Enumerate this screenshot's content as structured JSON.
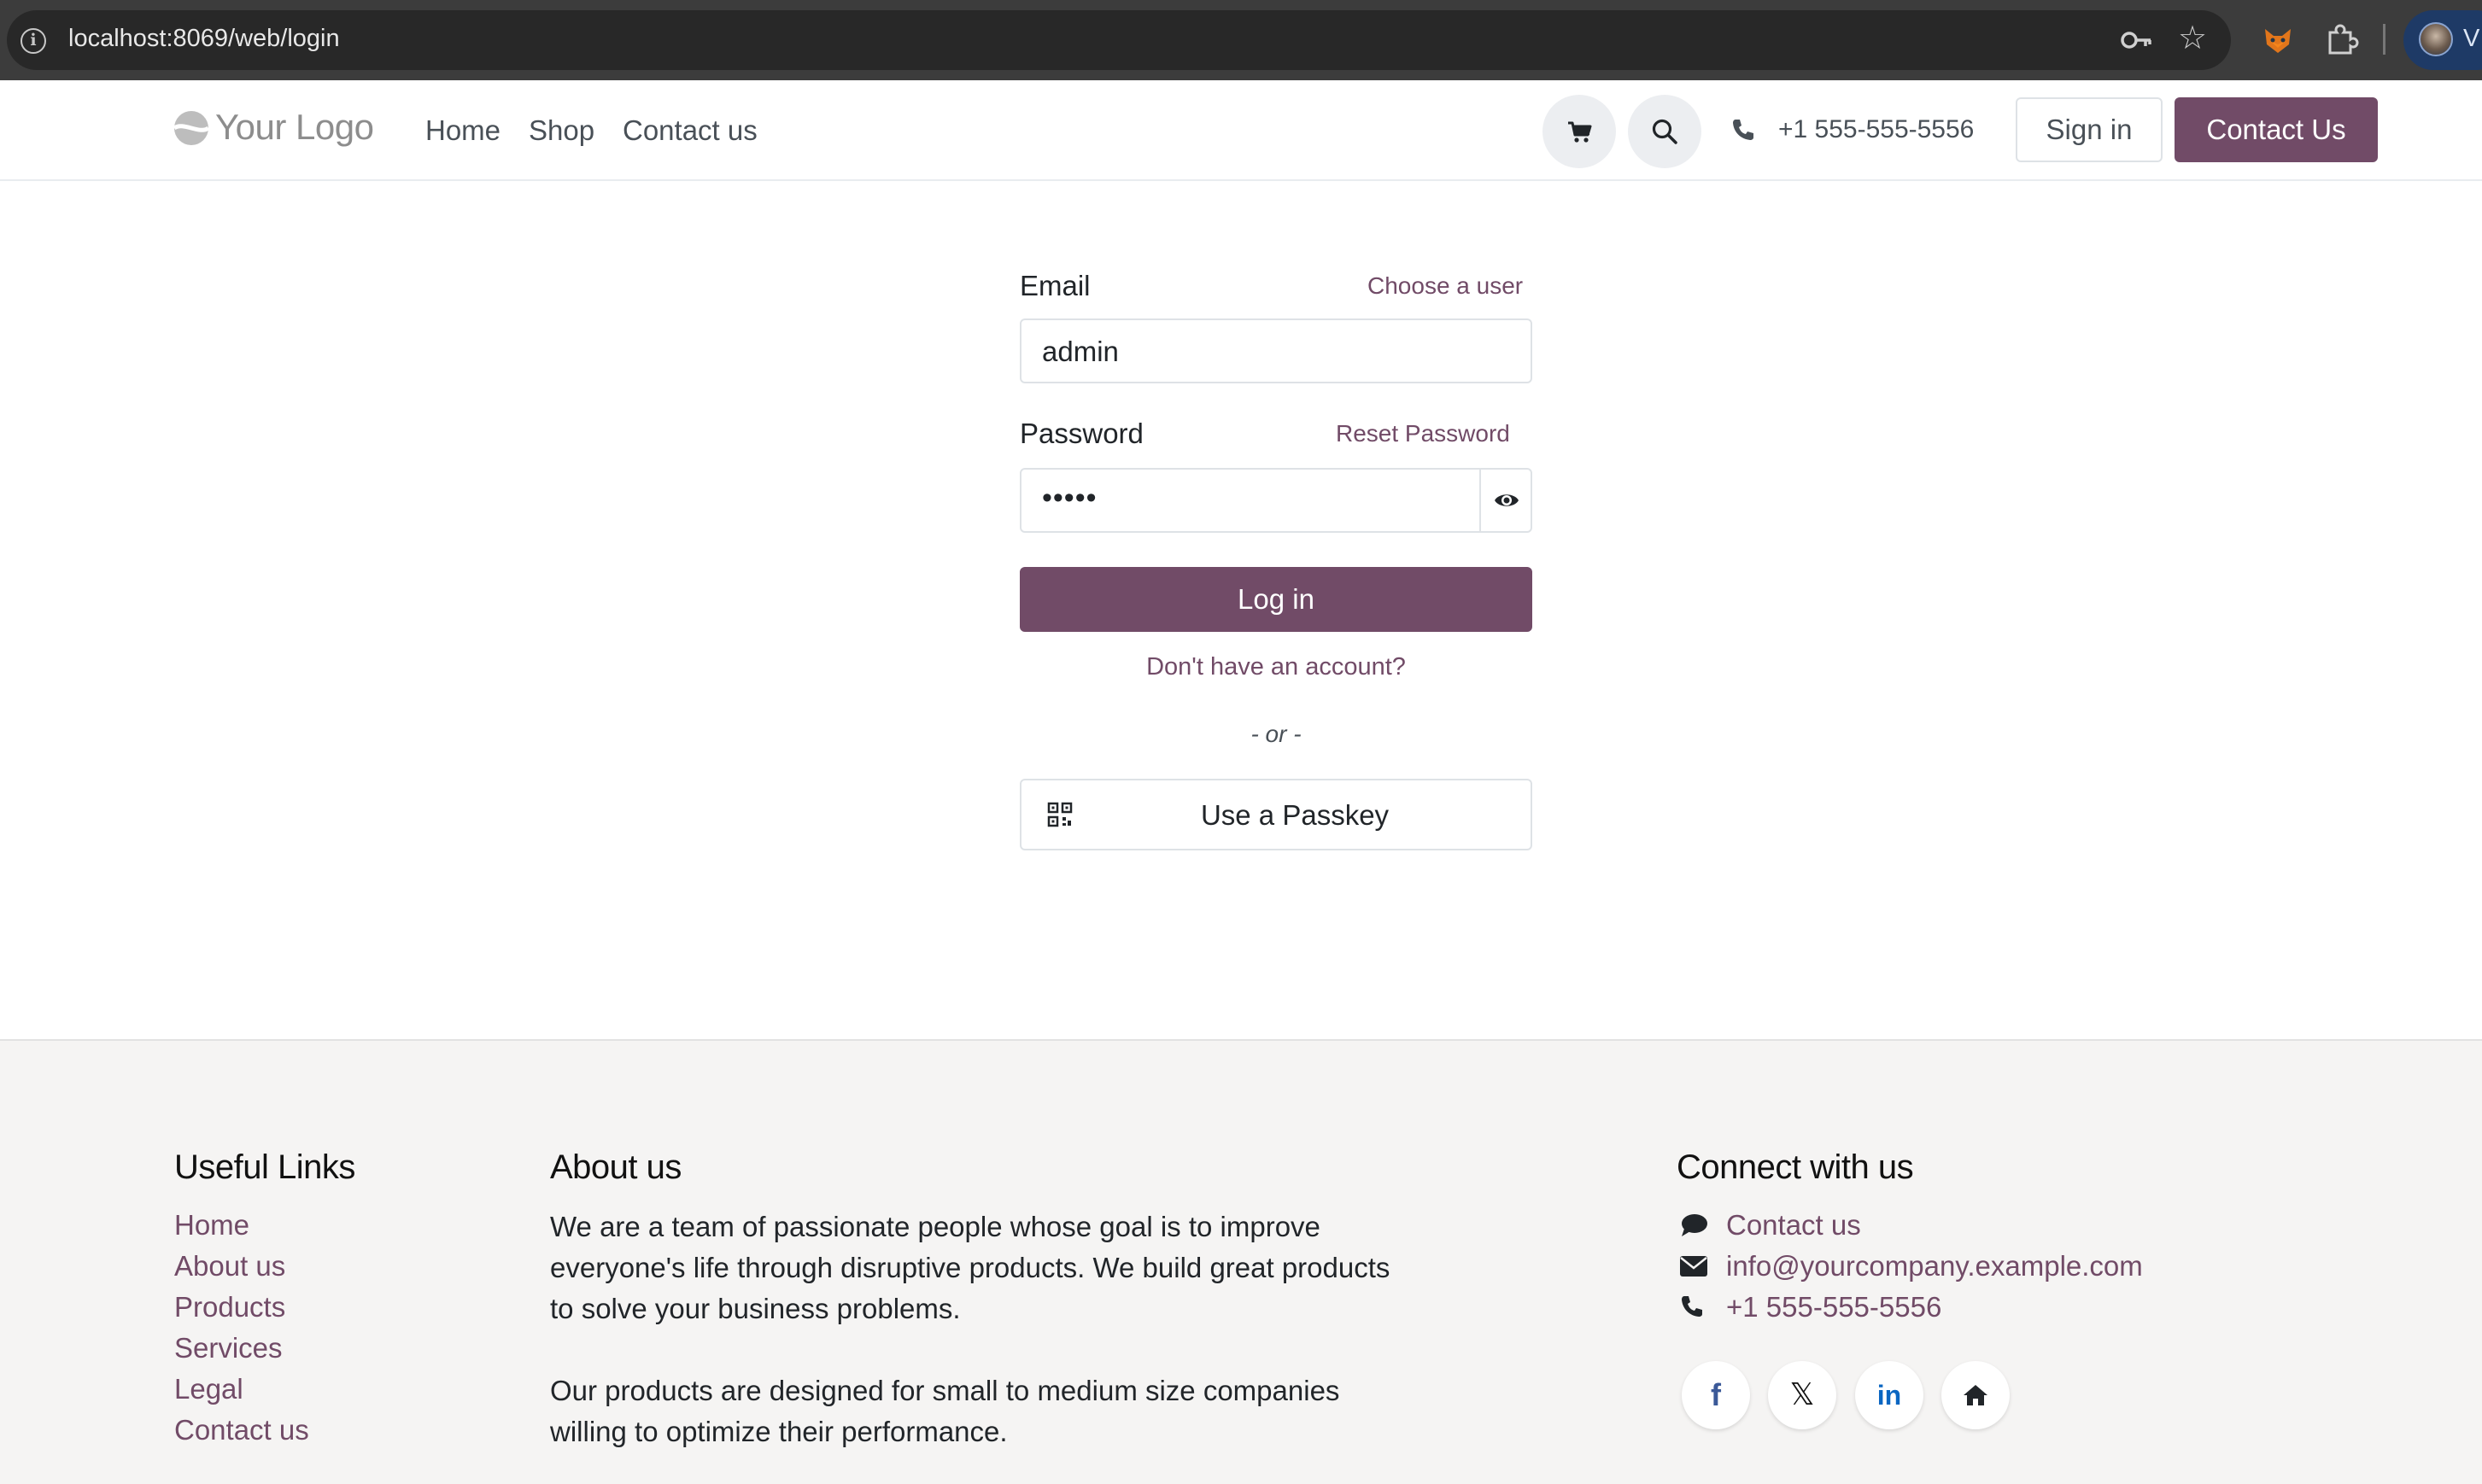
{
  "browser": {
    "url": "localhost:8069/web/login",
    "profile_initial": "V"
  },
  "header": {
    "logo_text": "Your Logo",
    "nav": [
      "Home",
      "Shop",
      "Contact us"
    ],
    "phone": "+1 555-555-5556",
    "sign_in_label": "Sign in",
    "contact_label": "Contact Us"
  },
  "login": {
    "email_label": "Email",
    "choose_user_label": "Choose a user",
    "email_value": "admin",
    "password_label": "Password",
    "reset_password_label": "Reset Password",
    "password_masked": "•••••",
    "login_label": "Log in",
    "signup_label": "Don't have an account?",
    "or_label": "- or -",
    "passkey_label": "Use a Passkey"
  },
  "footer": {
    "useful_links": {
      "title": "Useful Links",
      "items": [
        "Home",
        "About us",
        "Products",
        "Services",
        "Legal",
        "Contact us"
      ]
    },
    "about": {
      "title": "About us",
      "lines": [
        "We are a team of passionate people whose goal is to improve",
        "everyone's life through disruptive products. We build great products",
        "to solve your business problems.",
        "Our products are designed for small to medium size companies",
        "willing to optimize their performance."
      ]
    },
    "connect": {
      "title": "Connect with us",
      "contact_us": "Contact us",
      "email": "info@yourcompany.example.com",
      "phone": "+1 555-555-5556",
      "socials": [
        "facebook-icon",
        "x-icon",
        "linkedin-icon",
        "home-icon"
      ]
    }
  },
  "colors": {
    "brand": "#714b67",
    "footer_bg": "#f5f4f3",
    "chrome_bg": "#3c3c3c"
  }
}
